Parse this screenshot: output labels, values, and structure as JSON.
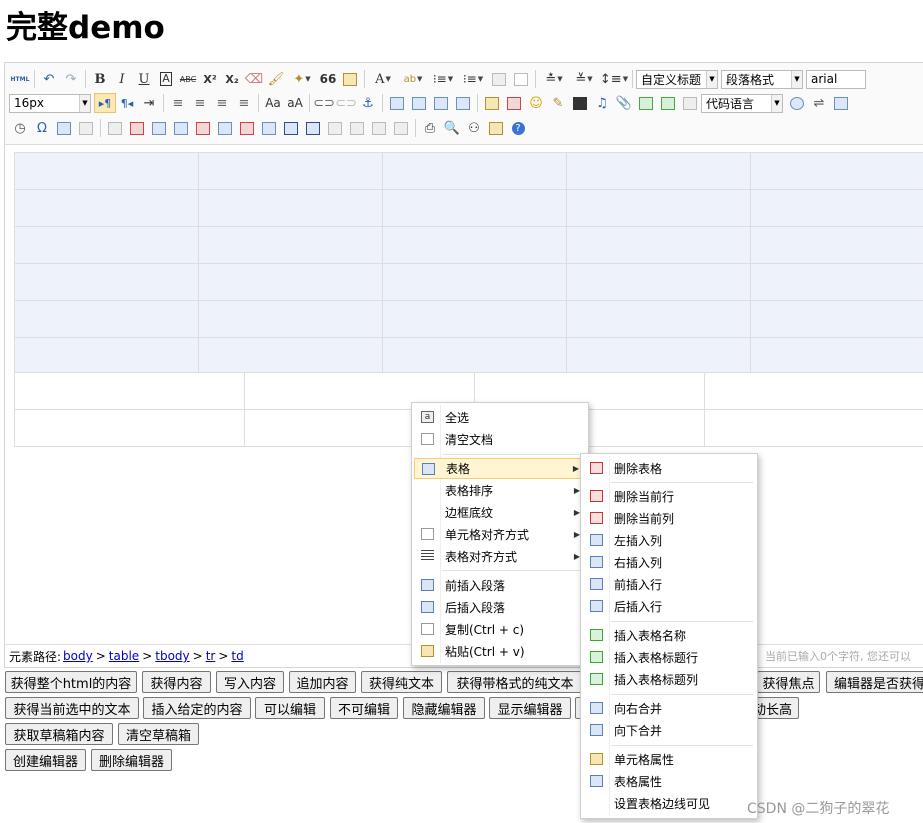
{
  "page_title": "完整demo",
  "toolbar": {
    "row1_labels": {
      "bold": "B",
      "italic": "I",
      "underline": "U",
      "strike": "ABC",
      "sup": "X²",
      "sub": "X₂",
      "quote": "66"
    },
    "custom_heading": "自定义标题",
    "paragraph_format": "段落格式",
    "font_family": "arial",
    "font_size": "16px",
    "code_language": "代码语言"
  },
  "statusbar": {
    "path_label": "元素路径:",
    "path": [
      "body",
      "table",
      "tbody",
      "tr",
      "td"
    ],
    "counter": "当前已输入0个字符, 您还可以"
  },
  "buttons": {
    "get_all_html": "获得整个html的内容",
    "get_content": "获得内容",
    "set_content": "写入内容",
    "append_content": "追加内容",
    "get_plain_text": "获得纯文本",
    "get_formatted_text": "获得带格式的纯文本",
    "get_focus": "获得焦点",
    "is_focused": "编辑器是否获得",
    "get_selected_text": "获得当前选中的文本",
    "insert_content": "插入给定的内容",
    "enable_edit": "可以编辑",
    "disable_edit": "不可编辑",
    "hide_editor": "隐藏编辑器",
    "show_editor": "显示编辑器",
    "auto_height": "动长高",
    "get_draft": "获取草稿箱内容",
    "clear_draft": "清空草稿箱",
    "create_editor": "创建编辑器",
    "delete_editor": "删除编辑器"
  },
  "context_menu": {
    "select_all": "全选",
    "clear_doc": "清空文档",
    "table": "表格",
    "table_sort": "表格排序",
    "border_shading": "边框底纹",
    "cell_align": "单元格对齐方式",
    "table_align": "表格对齐方式",
    "insert_para_before": "前插入段落",
    "insert_para_after": "后插入段落",
    "copy": "复制(Ctrl + c)",
    "paste": "粘贴(Ctrl + v)"
  },
  "table_submenu": {
    "delete_table": "删除表格",
    "delete_row": "删除当前行",
    "delete_col": "删除当前列",
    "insert_col_left": "左插入列",
    "insert_col_right": "右插入列",
    "insert_row_before": "前插入行",
    "insert_row_after": "后插入行",
    "insert_caption": "插入表格名称",
    "insert_title_row": "插入表格标题行",
    "insert_title_col": "插入表格标题列",
    "merge_right": "向右合并",
    "merge_down": "向下合并",
    "cell_props": "单元格属性",
    "table_props": "表格属性",
    "show_borders": "设置表格边线可见"
  },
  "watermark": "CSDN @二狗子的翠花"
}
